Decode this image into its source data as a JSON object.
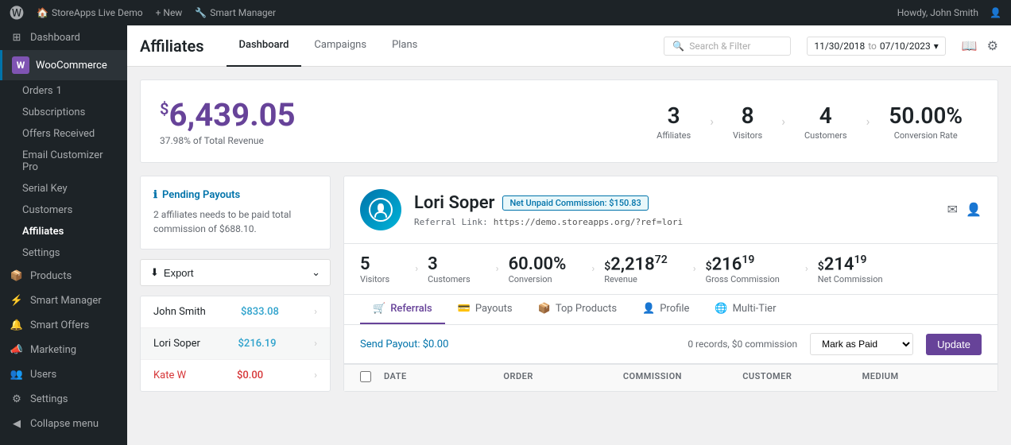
{
  "adminBar": {
    "wpIcon": "🅦",
    "siteName": "StoreApps Live Demo",
    "newLabel": "+ New",
    "pluginName": "Smart Manager",
    "howdy": "Howdy, John Smith"
  },
  "sidebar": {
    "dashboard": "Dashboard",
    "woocommerce": "WooCommerce",
    "orders": "Orders",
    "ordersBadge": "1",
    "subscriptions": "Subscriptions",
    "offersReceived": "Offers Received",
    "emailCustomizer": "Email Customizer Pro",
    "serialKey": "Serial Key",
    "customers": "Customers",
    "affiliates": "Affiliates",
    "settings": "Settings",
    "products": "Products",
    "smartManager": "Smart Manager",
    "smartOffers": "Smart Offers",
    "marketing": "Marketing",
    "users": "Users",
    "settingsBottom": "Settings",
    "collapseMenu": "Collapse menu"
  },
  "header": {
    "title": "Affiliates",
    "tabs": [
      "Dashboard",
      "Campaigns",
      "Plans"
    ],
    "activeTab": "Dashboard",
    "searchPlaceholder": "Search & Filter",
    "dateFrom": "11/30/2018",
    "dateTo": "07/10/2023"
  },
  "stats": {
    "currency": "$",
    "amount": "6,439.05",
    "subtitle": "37.98% of Total Revenue",
    "affiliates": {
      "value": "3",
      "label": "Affiliates"
    },
    "visitors": {
      "value": "8",
      "label": "Visitors"
    },
    "customers": {
      "value": "4",
      "label": "Customers"
    },
    "conversionRate": {
      "value": "50.00%",
      "label": "Conversion Rate"
    }
  },
  "pendingPayouts": {
    "title": "Pending Payouts",
    "description": "2 affiliates needs to be paid total commission of $688.10.",
    "exportLabel": "Export"
  },
  "affiliateList": [
    {
      "name": "John Smith",
      "amount": "$833.08",
      "color": "green"
    },
    {
      "name": "Lori Soper",
      "amount": "$216.19",
      "color": "green"
    },
    {
      "name": "Kate W",
      "amount": "$0.00",
      "color": "red"
    }
  ],
  "affiliateDetail": {
    "name": "Lori Soper",
    "badge": "Net Unpaid Commission: $150.83",
    "referralLinkLabel": "Referral Link:",
    "referralLink": "https://demo.storeapps.org/?ref=lori",
    "stats": {
      "visitors": {
        "value": "5",
        "label": "Visitors"
      },
      "customers": {
        "value": "3",
        "label": "Customers"
      },
      "conversion": {
        "value": "60.00%",
        "label": "Conversion"
      },
      "revenue": {
        "whole": "2,218",
        "decimal": "72",
        "label": "Revenue",
        "currency": "$"
      },
      "grossCommission": {
        "whole": "216",
        "decimal": "19",
        "label": "Gross Commission",
        "currency": "$"
      },
      "netCommission": {
        "whole": "214",
        "decimal": "19",
        "label": "Net Commission",
        "currency": "$"
      }
    },
    "tabs": [
      "Referrals",
      "Payouts",
      "Top Products",
      "Profile",
      "Multi-Tier"
    ],
    "activeTab": "Referrals",
    "tabIcons": [
      "🛒",
      "💳",
      "📦",
      "👤",
      "🌐"
    ],
    "payoutText": "Send Payout: $0.00",
    "records": "0 records, $0 commission",
    "markPaidLabel": "Mark as Paid",
    "updateLabel": "Update",
    "tableHeaders": [
      "DATE",
      "ORDER",
      "COMMISSION",
      "CUSTOMER",
      "MEDIUM"
    ]
  }
}
